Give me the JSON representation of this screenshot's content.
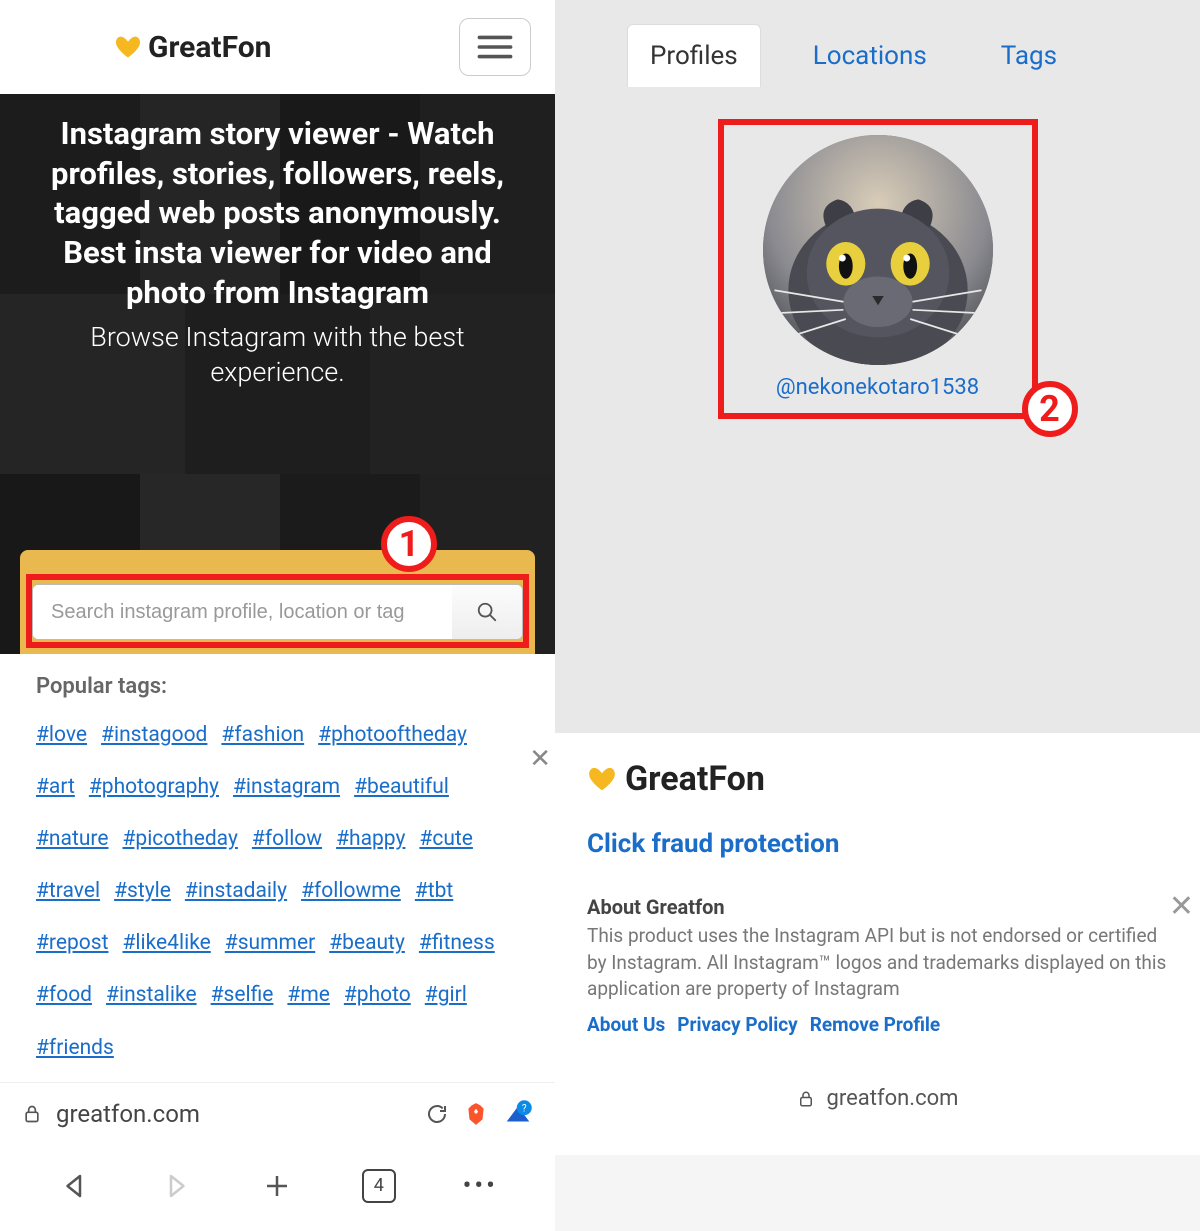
{
  "left": {
    "logo": "GreatFon",
    "hero": {
      "title": "Instagram story viewer - Watch profiles, stories, followers, reels, tagged web posts anonymously. Best insta viewer for video and photo from Instagram",
      "subtitle": "Browse Instagram with the best experience."
    },
    "search": {
      "placeholder": "Search instagram profile, location or tag"
    },
    "annotation1": "1",
    "tags_title": "Popular tags:",
    "tags": [
      "#love",
      "#instagood",
      "#fashion",
      "#photooftheday",
      "#art",
      "#photography",
      "#instagram",
      "#beautiful",
      "#nature",
      "#picotheday",
      "#follow",
      "#happy",
      "#cute",
      "#travel",
      "#style",
      "#instadaily",
      "#followme",
      "#tbt",
      "#repost",
      "#like4like",
      "#summer",
      "#beauty",
      "#fitness",
      "#food",
      "#instalike",
      "#selfie",
      "#me",
      "#photo",
      "#girl",
      "#friends"
    ],
    "address": "greatfon.com",
    "tab_count": "4"
  },
  "right": {
    "tabs": {
      "profiles": "Profiles",
      "locations": "Locations",
      "tags": "Tags"
    },
    "annotation2": "2",
    "handle": "@nekonekotaro1538",
    "footer_logo": "GreatFon",
    "fraud": "Click fraud protection",
    "about_title": "About Greatfon",
    "about_text": "This product uses the Instagram API but is not endorsed or certified by Instagram. All Instagram™ logos and trademarks displayed on this application are property of Instagram",
    "links": {
      "about": "About Us",
      "privacy": "Privacy Policy",
      "remove": "Remove Profile"
    },
    "address": "greatfon.com"
  }
}
